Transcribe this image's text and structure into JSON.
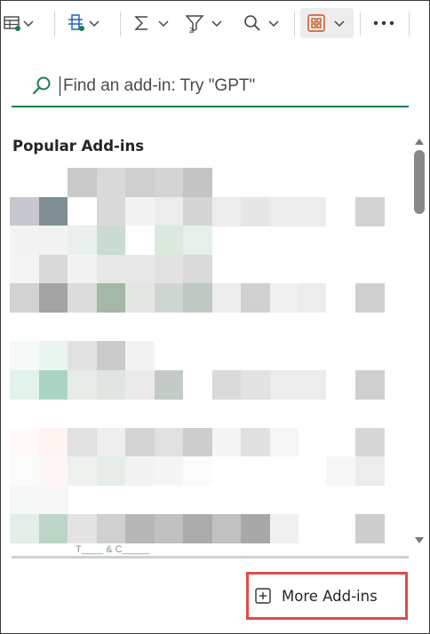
{
  "toolbar": {
    "buttons": [
      {
        "name": "insert-table-icon"
      },
      {
        "name": "format-table-icon"
      },
      {
        "name": "autosum-icon"
      },
      {
        "name": "sort-filter-icon"
      },
      {
        "name": "find-select-icon"
      },
      {
        "name": "add-ins-icon",
        "active": true
      },
      {
        "name": "more-options-icon"
      }
    ],
    "more_label": "•••"
  },
  "search": {
    "placeholder": "Find an add-in: Try \"GPT\"",
    "value": ""
  },
  "section_title": "Popular Add-ins",
  "list": {
    "truncated_last_item_text": "T____ & C_____"
  },
  "footer": {
    "more_addins_label": "More Add-ins"
  },
  "colors": {
    "accent_green": "#1a7f4b",
    "addin_active_orange": "#c8511e",
    "highlight_red": "#e04a4a"
  }
}
